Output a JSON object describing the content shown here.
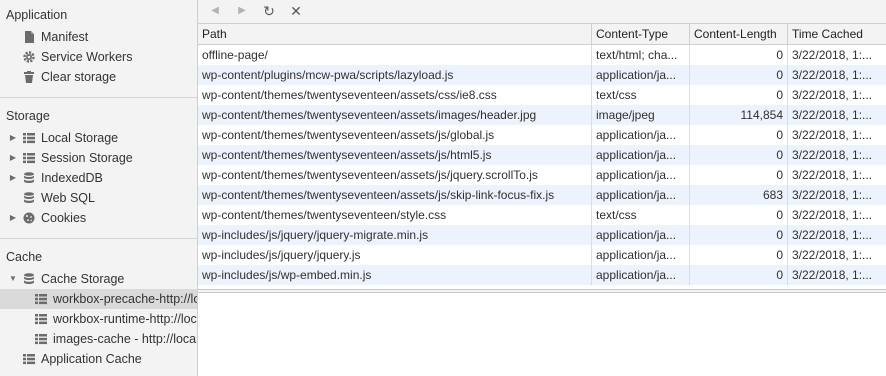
{
  "sidebar": {
    "application": {
      "title": "Application",
      "items": [
        {
          "label": "Manifest",
          "icon": "document-icon"
        },
        {
          "label": "Service Workers",
          "icon": "gear-icon"
        },
        {
          "label": "Clear storage",
          "icon": "trash-icon"
        }
      ]
    },
    "storage": {
      "title": "Storage",
      "items": [
        {
          "label": "Local Storage",
          "icon": "grid-icon",
          "expandable": true
        },
        {
          "label": "Session Storage",
          "icon": "grid-icon",
          "expandable": true
        },
        {
          "label": "IndexedDB",
          "icon": "database-icon",
          "expandable": true
        },
        {
          "label": "Web SQL",
          "icon": "database-icon",
          "expandable": false
        },
        {
          "label": "Cookies",
          "icon": "cookie-icon",
          "expandable": true
        }
      ]
    },
    "cache": {
      "title": "Cache",
      "items": [
        {
          "label": "Cache Storage",
          "icon": "database-icon",
          "expanded": true
        },
        {
          "label": "workbox-precache-http://lo",
          "icon": "grid-icon",
          "selected": true
        },
        {
          "label": "workbox-runtime-http://loc",
          "icon": "grid-icon"
        },
        {
          "label": "images-cache - http://local",
          "icon": "grid-icon"
        },
        {
          "label": "Application Cache",
          "icon": "grid-icon"
        }
      ]
    }
  },
  "toolbar": {
    "back_icon": "◀",
    "forward_icon": "▶",
    "refresh_icon": "↻",
    "delete_icon": "✕"
  },
  "table": {
    "columns": [
      "Path",
      "Content-Type",
      "Content-Length",
      "Time Cached"
    ],
    "rows": [
      [
        "offline-page/",
        "text/html; cha...",
        "0",
        "3/22/2018, 1:..."
      ],
      [
        "wp-content/plugins/mcw-pwa/scripts/lazyload.js",
        "application/ja...",
        "0",
        "3/22/2018, 1:..."
      ],
      [
        "wp-content/themes/twentyseventeen/assets/css/ie8.css",
        "text/css",
        "0",
        "3/22/2018, 1:..."
      ],
      [
        "wp-content/themes/twentyseventeen/assets/images/header.jpg",
        "image/jpeg",
        "114,854",
        "3/22/2018, 1:..."
      ],
      [
        "wp-content/themes/twentyseventeen/assets/js/global.js",
        "application/ja...",
        "0",
        "3/22/2018, 1:..."
      ],
      [
        "wp-content/themes/twentyseventeen/assets/js/html5.js",
        "application/ja...",
        "0",
        "3/22/2018, 1:..."
      ],
      [
        "wp-content/themes/twentyseventeen/assets/js/jquery.scrollTo.js",
        "application/ja...",
        "0",
        "3/22/2018, 1:..."
      ],
      [
        "wp-content/themes/twentyseventeen/assets/js/skip-link-focus-fix.js",
        "application/ja...",
        "683",
        "3/22/2018, 1:..."
      ],
      [
        "wp-content/themes/twentyseventeen/style.css",
        "text/css",
        "0",
        "3/22/2018, 1:..."
      ],
      [
        "wp-includes/js/jquery/jquery-migrate.min.js",
        "application/ja...",
        "0",
        "3/22/2018, 1:..."
      ],
      [
        "wp-includes/js/jquery/jquery.js",
        "application/ja...",
        "0",
        "3/22/2018, 1:..."
      ],
      [
        "wp-includes/js/wp-embed.min.js",
        "application/ja...",
        "0",
        "3/22/2018, 1:..."
      ]
    ]
  }
}
